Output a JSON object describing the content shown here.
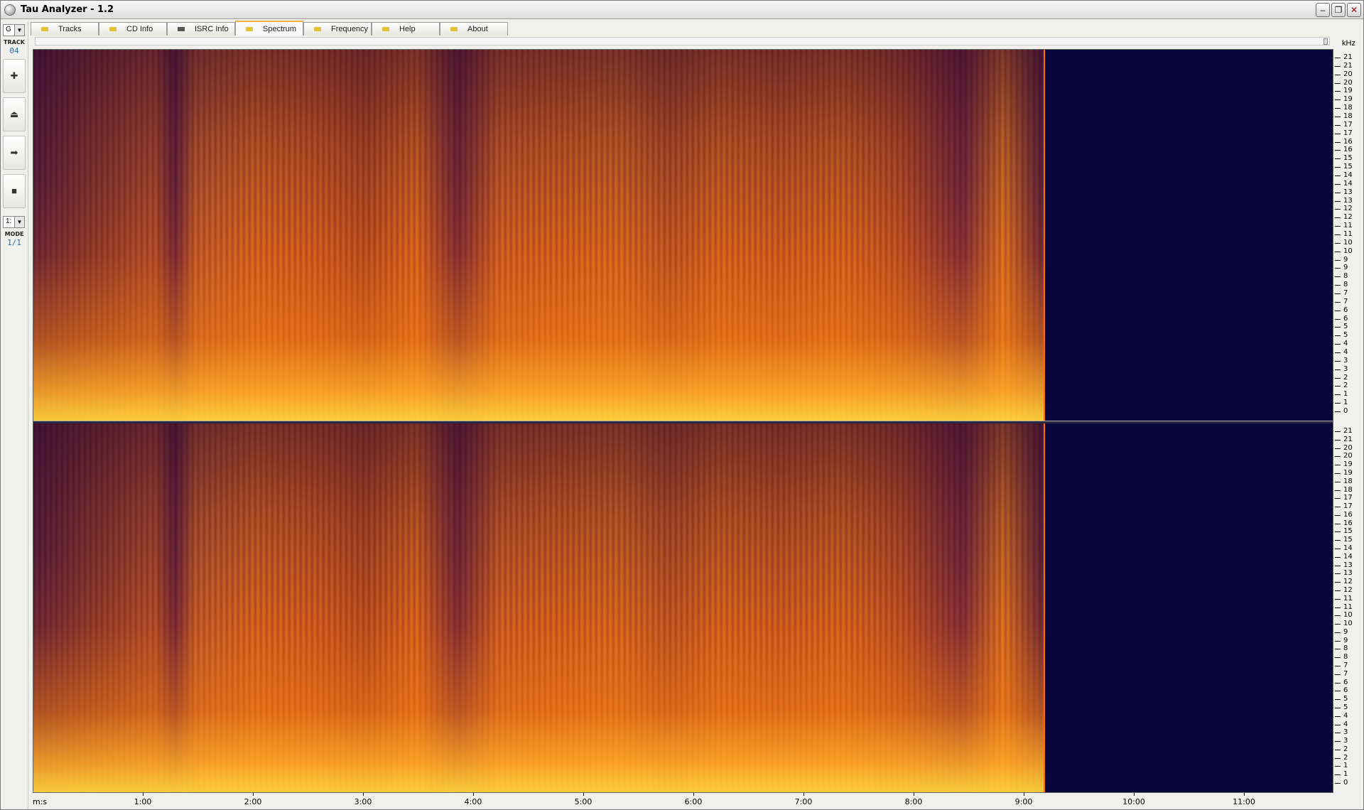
{
  "window": {
    "title": "Tau Analyzer - 1.2"
  },
  "controls": {
    "minimize": "‒",
    "maximize": "❐",
    "close": "✕"
  },
  "tabs": [
    {
      "label": "Tracks",
      "flag": "#e2c23a",
      "active": false
    },
    {
      "label": "CD Info",
      "flag": "#e2c23a",
      "active": false
    },
    {
      "label": "ISRC Info",
      "flag": "#555555",
      "active": false
    },
    {
      "label": "Spectrum",
      "flag": "#e2c23a",
      "active": true
    },
    {
      "label": "Frequency",
      "flag": "#e2c23a",
      "active": false
    },
    {
      "label": "Help",
      "flag": "#e2c23a",
      "active": false
    },
    {
      "label": "About",
      "flag": "#e2c23a",
      "active": false
    }
  ],
  "sidebar": {
    "combo_top": "G",
    "track_label": "TRACK",
    "track_value": "04",
    "buttons": [
      {
        "name": "add-icon",
        "glyph": "✚"
      },
      {
        "name": "eject-icon",
        "glyph": "⏏"
      },
      {
        "name": "next-icon",
        "glyph": "➡"
      },
      {
        "name": "stop-icon",
        "glyph": "■"
      }
    ],
    "combo_mode": "1:",
    "mode_label": "MODE",
    "mode_value": "1/1"
  },
  "axis": {
    "khz_label": "kHz",
    "khz_ticks": [
      "21",
      "21",
      "20",
      "20",
      "19",
      "19",
      "18",
      "18",
      "17",
      "17",
      "16",
      "16",
      "15",
      "15",
      "14",
      "14",
      "13",
      "13",
      "12",
      "12",
      "11",
      "11",
      "10",
      "10",
      "9",
      "9",
      "8",
      "8",
      "7",
      "7",
      "6",
      "6",
      "5",
      "5",
      "4",
      "4",
      "3",
      "3",
      "2",
      "2",
      "1",
      "1",
      "0"
    ],
    "time_label": "m:s",
    "time_ticks": [
      "1:00",
      "2:00",
      "3:00",
      "4:00",
      "5:00",
      "6:00",
      "7:00",
      "8:00",
      "9:00",
      "10:00",
      "11:00"
    ]
  },
  "colors": {
    "empty_region": "#06063a",
    "end_marker": "#ff6a10",
    "active_tab_accent": "#f3b03c"
  }
}
